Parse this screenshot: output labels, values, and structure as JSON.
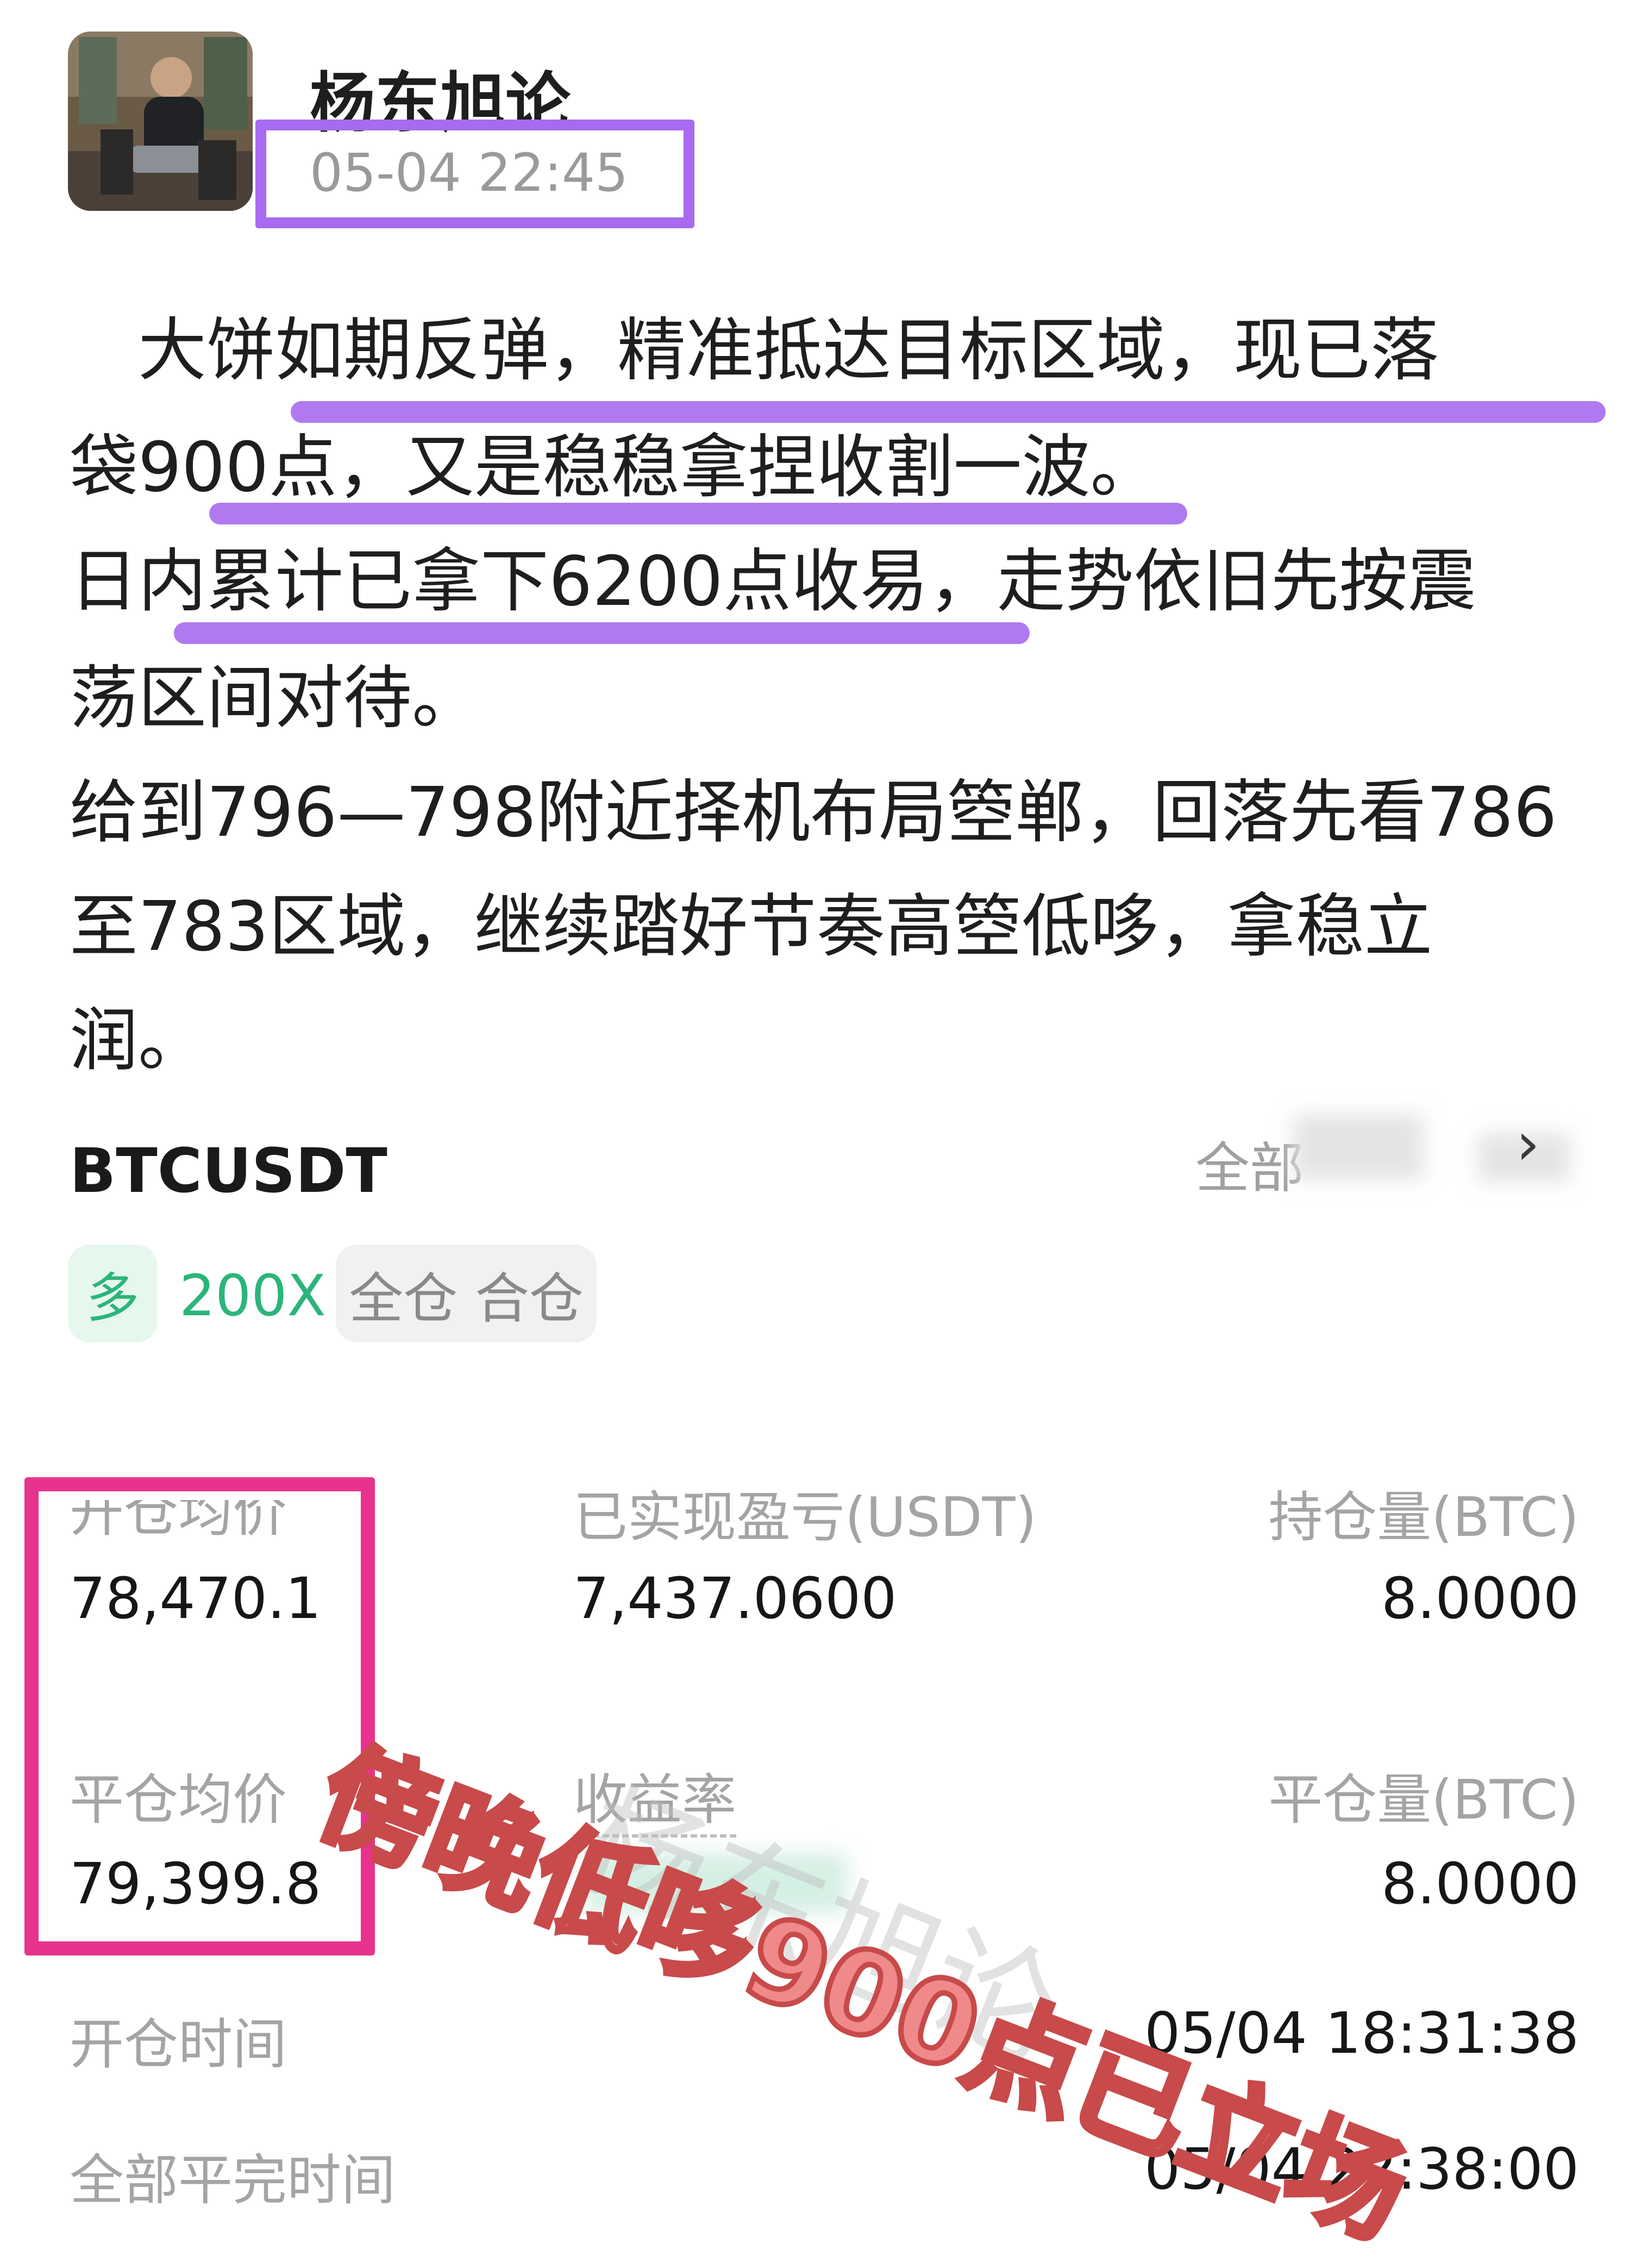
{
  "post": {
    "author": "杨东旭论",
    "time": "05-04 22:45",
    "lines": [
      "　大饼如期反弹，精准抵达目标区域，现已落",
      "袋900点，又是稳稳拿捏收割一波。",
      "日内累计已拿下6200点收易，走势依旧先按震",
      "荡区间对待。",
      "给到796—798附近择机布局箜郸，回落先看786",
      "至783区域，继续踏好节奏高箜低哆，拿稳立",
      "润。"
    ]
  },
  "position": {
    "symbol": "BTCUSDT",
    "filter_label": "全部",
    "side": "多",
    "leverage": "200X",
    "mode": "全仓 合仓",
    "fields": {
      "open_avg_label": "开仓均价",
      "open_avg_value": "78,470.1",
      "realized_pnl_label": "已实现盈亏(USDT)",
      "realized_pnl_value": "7,437.0600",
      "position_size_label": "持仓量(BTC)",
      "position_size_value": "8.0000",
      "close_avg_label": "平仓均价",
      "close_avg_value": "79,399.8",
      "roi_label": "收益率",
      "close_size_label": "平仓量(BTC)",
      "close_size_value": "8.0000",
      "open_time_label": "开仓时间",
      "open_time_value": "05/04 18:31:38",
      "close_time_label": "全部平完时间",
      "close_time_value": "05/04 22:38:00"
    }
  },
  "watermark": "杨东旭论",
  "overlay_text": "傍晚低哆900点已立场",
  "colors": {
    "highlight_purple": "#b179f0",
    "box_pink": "#e8338d",
    "long_green": "#2bb57a"
  }
}
